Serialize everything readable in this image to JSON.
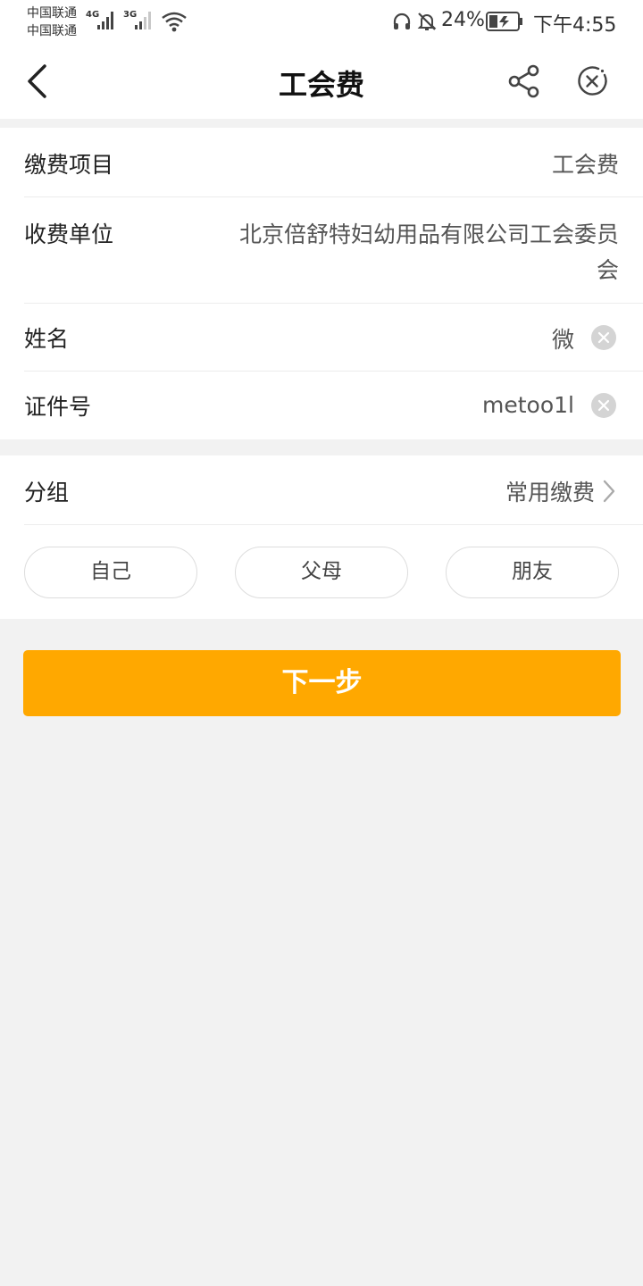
{
  "status_bar": {
    "carrier_1": "中国联通",
    "carrier_2": "中国联通",
    "network_1": "4G",
    "network_2": "3G",
    "battery": "24%",
    "time": "下午4:55"
  },
  "header": {
    "title": "工会费",
    "back_icon": "chevron-left-icon",
    "share_icon": "share-icon",
    "close_icon": "close-circle-icon"
  },
  "form": {
    "item_label": "缴费项目",
    "item_value": "工会费",
    "payee_label": "收费单位",
    "payee_value_line1": "北京倍舒特妇幼用品有限公司工会委员",
    "payee_value_line2": "会",
    "name_label": "姓名",
    "name_value": "微",
    "id_label": "证件号",
    "id_value": "metoo1l"
  },
  "group": {
    "label": "分组",
    "value": "常用缴费",
    "chips": [
      "自己",
      "父母",
      "朋友"
    ]
  },
  "next_button": "下一步",
  "colors": {
    "accent": "#ffa800",
    "background": "#f2f2f2"
  }
}
